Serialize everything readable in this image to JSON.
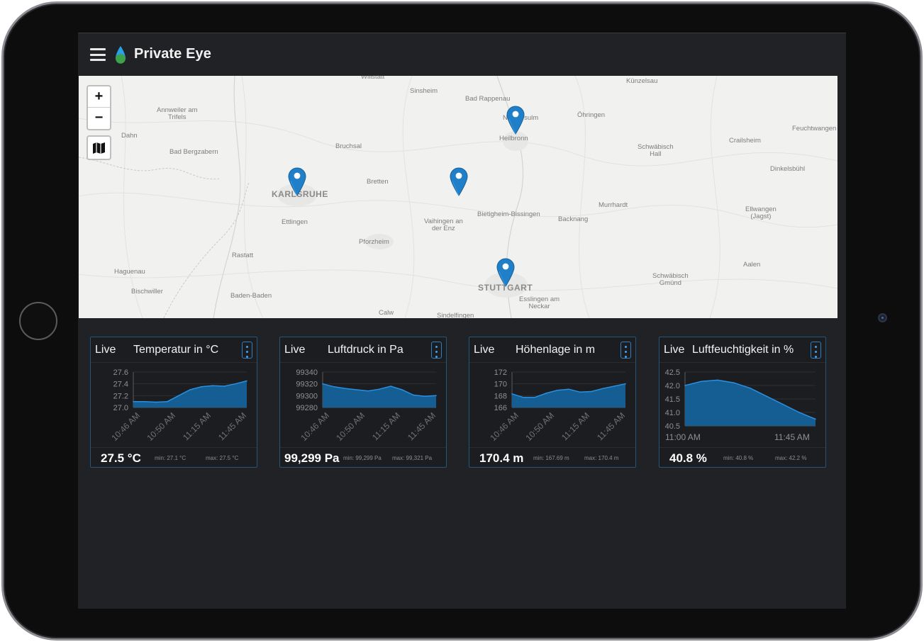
{
  "app": {
    "title": "Private Eye"
  },
  "map": {
    "zoom_in": "+",
    "zoom_out": "−",
    "places": [
      {
        "name": "Willstätt",
        "cls": ""
      },
      {
        "name": "Sinsheim",
        "cls": ""
      },
      {
        "name": "Bad Rappenau",
        "cls": ""
      },
      {
        "name": "Künzelsau",
        "cls": ""
      },
      {
        "name": "Annweiler am Trifels",
        "cls": ""
      },
      {
        "name": "Neckarsulm",
        "cls": ""
      },
      {
        "name": "Öhringen",
        "cls": ""
      },
      {
        "name": "Feuchtwangen",
        "cls": ""
      },
      {
        "name": "Dahn",
        "cls": ""
      },
      {
        "name": "Heilbronn",
        "cls": ""
      },
      {
        "name": "Bruchsal",
        "cls": ""
      },
      {
        "name": "Schwäbisch Hall",
        "cls": ""
      },
      {
        "name": "Crailsheim",
        "cls": ""
      },
      {
        "name": "Bad Bergzabern",
        "cls": ""
      },
      {
        "name": "Dinkelsbühl",
        "cls": ""
      },
      {
        "name": "Bretten",
        "cls": ""
      },
      {
        "name": "KARLSRUHE",
        "cls": "big"
      },
      {
        "name": "Murrhardt",
        "cls": ""
      },
      {
        "name": "Bietigheim-Bissingen",
        "cls": ""
      },
      {
        "name": "Ellwangen (Jagst)",
        "cls": ""
      },
      {
        "name": "Ettlingen",
        "cls": ""
      },
      {
        "name": "Vaihingen an der Enz",
        "cls": ""
      },
      {
        "name": "Backnang",
        "cls": ""
      },
      {
        "name": "Pforzheim",
        "cls": ""
      },
      {
        "name": "Rastatt",
        "cls": ""
      },
      {
        "name": "Aalen",
        "cls": ""
      },
      {
        "name": "Haguenau",
        "cls": ""
      },
      {
        "name": "Schwäbisch Gmünd",
        "cls": ""
      },
      {
        "name": "STUTTGART",
        "cls": "big"
      },
      {
        "name": "Bischwiller",
        "cls": ""
      },
      {
        "name": "Baden-Baden",
        "cls": ""
      },
      {
        "name": "Esslingen am Neckar",
        "cls": ""
      },
      {
        "name": "Calw",
        "cls": ""
      },
      {
        "name": "Sindelfingen",
        "cls": ""
      }
    ]
  },
  "cards": [
    {
      "live": "Live",
      "title": "Temperatur in °C",
      "value": "27.5 °C",
      "min": "min: 27.1 °C",
      "max": "max: 27.5 °C",
      "chart_data": {
        "type": "area",
        "yticks": [
          "27.6",
          "27.4",
          "27.2",
          "27.0"
        ],
        "xticks": [
          "10:46 AM",
          "10:50 AM",
          "11:15 AM",
          "11:45 AM"
        ],
        "ylim": [
          27.0,
          27.6
        ],
        "values": [
          27.1,
          27.1,
          27.09,
          27.1,
          27.2,
          27.3,
          27.35,
          27.37,
          27.36,
          27.4,
          27.45
        ]
      }
    },
    {
      "live": "Live",
      "title": "Luftdruck in Pa",
      "value": "99,299 Pa",
      "min": "min: 99,299 Pa",
      "max": "max: 99,321 Pa",
      "chart_data": {
        "type": "area",
        "yticks": [
          "99340",
          "99320",
          "99300",
          "99280"
        ],
        "xticks": [
          "10:46 AM",
          "10:50 AM",
          "11:15 AM",
          "11:45 AM"
        ],
        "ylim": [
          99280,
          99340
        ],
        "values": [
          99320,
          99315,
          99312,
          99310,
          99308,
          99311,
          99316,
          99310,
          99301,
          99299,
          99300
        ]
      }
    },
    {
      "live": "Live",
      "title": "Höhenlage in m",
      "value": "170.4 m",
      "min": "min: 167.69 m",
      "max": "max: 170.4 m",
      "chart_data": {
        "type": "area",
        "yticks": [
          "172",
          "170",
          "168",
          "166"
        ],
        "xticks": [
          "10:46 AM",
          "10:50 AM",
          "11:15 AM",
          "11:45 AM"
        ],
        "ylim": [
          166,
          172
        ],
        "values": [
          168.3,
          167.7,
          167.7,
          168.4,
          168.9,
          169.1,
          168.6,
          168.7,
          169.2,
          169.6,
          170.0
        ]
      }
    },
    {
      "live": "Live",
      "title": "Luftfeuchtigkeit in %",
      "value": "40.8 %",
      "min": "min: 40.8 %",
      "max": "max: 42.2 %",
      "chart_data": {
        "type": "area",
        "yticks": [
          "42.5",
          "42.0",
          "41.5",
          "41.0",
          "40.5"
        ],
        "xticks": [
          "11:00 AM",
          "11:45 AM"
        ],
        "ylim": [
          40.5,
          42.5
        ],
        "values": [
          42.0,
          42.15,
          42.2,
          42.1,
          41.9,
          41.6,
          41.3,
          41.0,
          40.75
        ]
      }
    }
  ]
}
